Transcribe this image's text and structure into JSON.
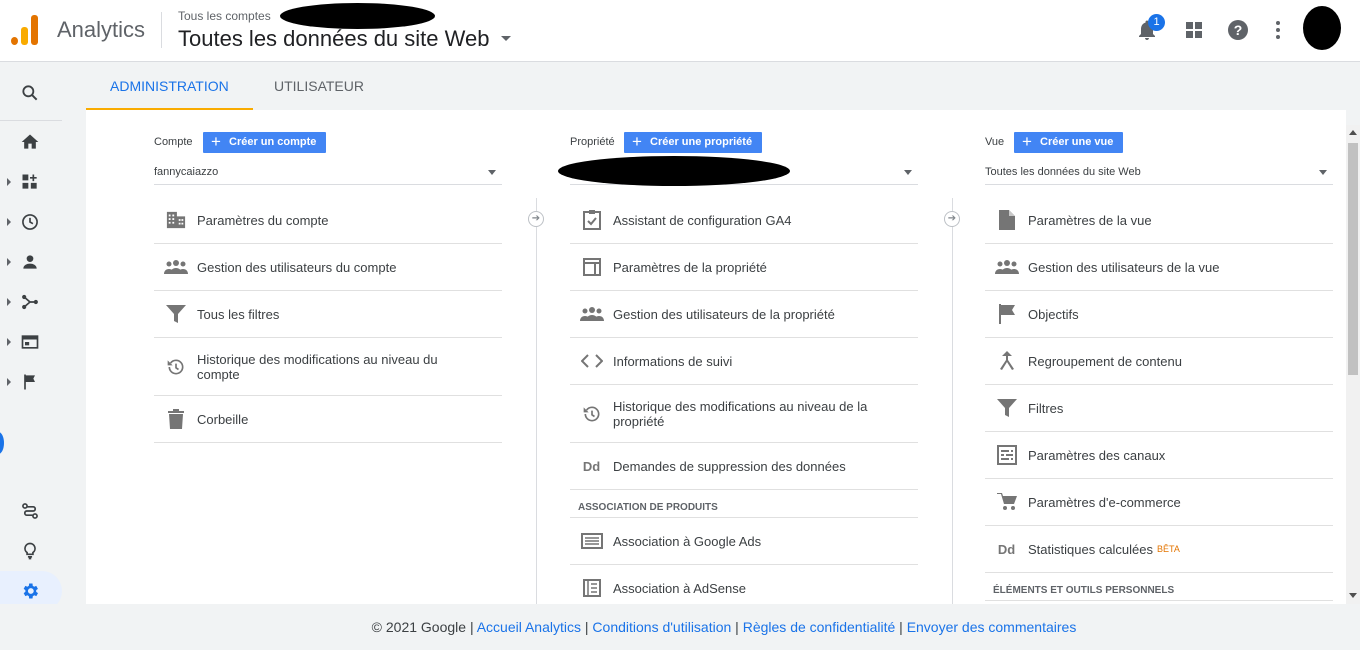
{
  "app": {
    "name": "Analytics",
    "accounts_label": "Tous les comptes",
    "view_title": "Toutes les données du site Web",
    "notification_count": "1"
  },
  "tabs": [
    {
      "label": "ADMINISTRATION",
      "active": true
    },
    {
      "label": "UTILISATEUR",
      "active": false
    }
  ],
  "account": {
    "label": "Compte",
    "create_label": "Créer un compte",
    "selected": "fannycaiazzo",
    "items": [
      {
        "label": "Paramètres du compte",
        "icon": "building-icon"
      },
      {
        "label": "Gestion des utilisateurs du compte",
        "icon": "people-icon"
      },
      {
        "label": "Tous les filtres",
        "icon": "filter-icon"
      },
      {
        "label": "Historique des modifications au niveau du compte",
        "icon": "history-icon"
      },
      {
        "label": "Corbeille",
        "icon": "trash-icon"
      }
    ]
  },
  "property": {
    "label": "Propriété",
    "create_label": "Créer une propriété",
    "selected": "",
    "items": [
      {
        "label": "Assistant de configuration GA4",
        "icon": "checklist-icon"
      },
      {
        "label": "Paramètres de la propriété",
        "icon": "layout-icon"
      },
      {
        "label": "Gestion des utilisateurs de la propriété",
        "icon": "people-icon"
      },
      {
        "label": "Informations de suivi",
        "icon": "code-icon"
      },
      {
        "label": "Historique des modifications au niveau de la propriété",
        "icon": "history-icon"
      },
      {
        "label": "Demandes de suppression des données",
        "icon": "dd-icon"
      }
    ],
    "section_label": "ASSOCIATION DE PRODUITS",
    "section_items": [
      {
        "label": "Association à Google Ads",
        "icon": "ads-icon"
      },
      {
        "label": "Association à AdSense",
        "icon": "adsense-icon"
      }
    ]
  },
  "view": {
    "label": "Vue",
    "create_label": "Créer une vue",
    "selected": "Toutes les données du site Web",
    "items": [
      {
        "label": "Paramètres de la vue",
        "icon": "document-icon"
      },
      {
        "label": "Gestion des utilisateurs de la vue",
        "icon": "people-icon"
      },
      {
        "label": "Objectifs",
        "icon": "flag-icon"
      },
      {
        "label": "Regroupement de contenu",
        "icon": "merge-icon"
      },
      {
        "label": "Filtres",
        "icon": "filter-icon"
      },
      {
        "label": "Paramètres des canaux",
        "icon": "channels-icon"
      },
      {
        "label": "Paramètres d'e-commerce",
        "icon": "cart-icon"
      },
      {
        "label": "Statistiques calculées",
        "icon": "dd-icon",
        "badge": "BÊTA"
      }
    ],
    "section_label": "ÉLÉMENTS ET OUTILS PERSONNELS"
  },
  "footer": {
    "copyright": "© 2021 Google",
    "links": [
      "Accueil Analytics",
      "Conditions d'utilisation",
      "Règles de confidentialité",
      "Envoyer des commentaires"
    ]
  },
  "colors": {
    "accent": "#1a73e8",
    "button": "#4285f4",
    "tab_indicator": "#f9ab00",
    "beta": "#e37400"
  }
}
